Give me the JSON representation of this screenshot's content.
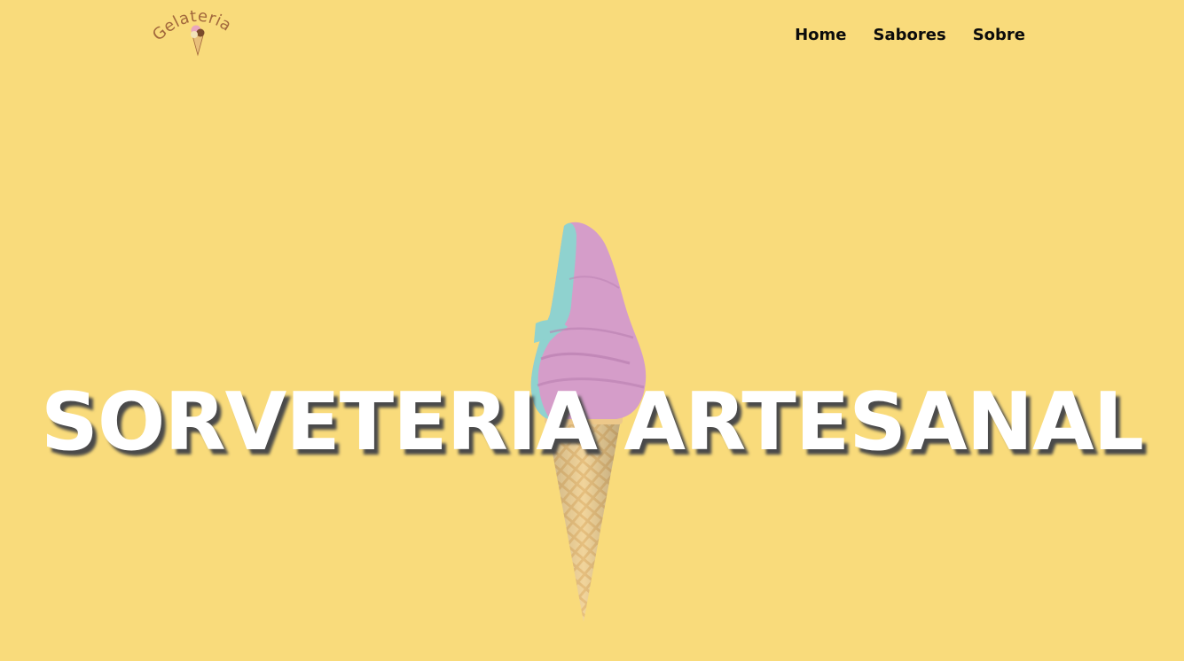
{
  "brand": {
    "logo_text": "Gelateria",
    "logo_color": "#a2683c"
  },
  "nav": {
    "items": [
      {
        "label": "Home"
      },
      {
        "label": "Sabores"
      },
      {
        "label": "Sobre"
      }
    ]
  },
  "hero": {
    "title": "SORVETERIA ARTESANAL",
    "image_icon": "soft-serve-ice-cream-cone",
    "background_color": "#f9db7b",
    "title_color": "#ffffff"
  }
}
